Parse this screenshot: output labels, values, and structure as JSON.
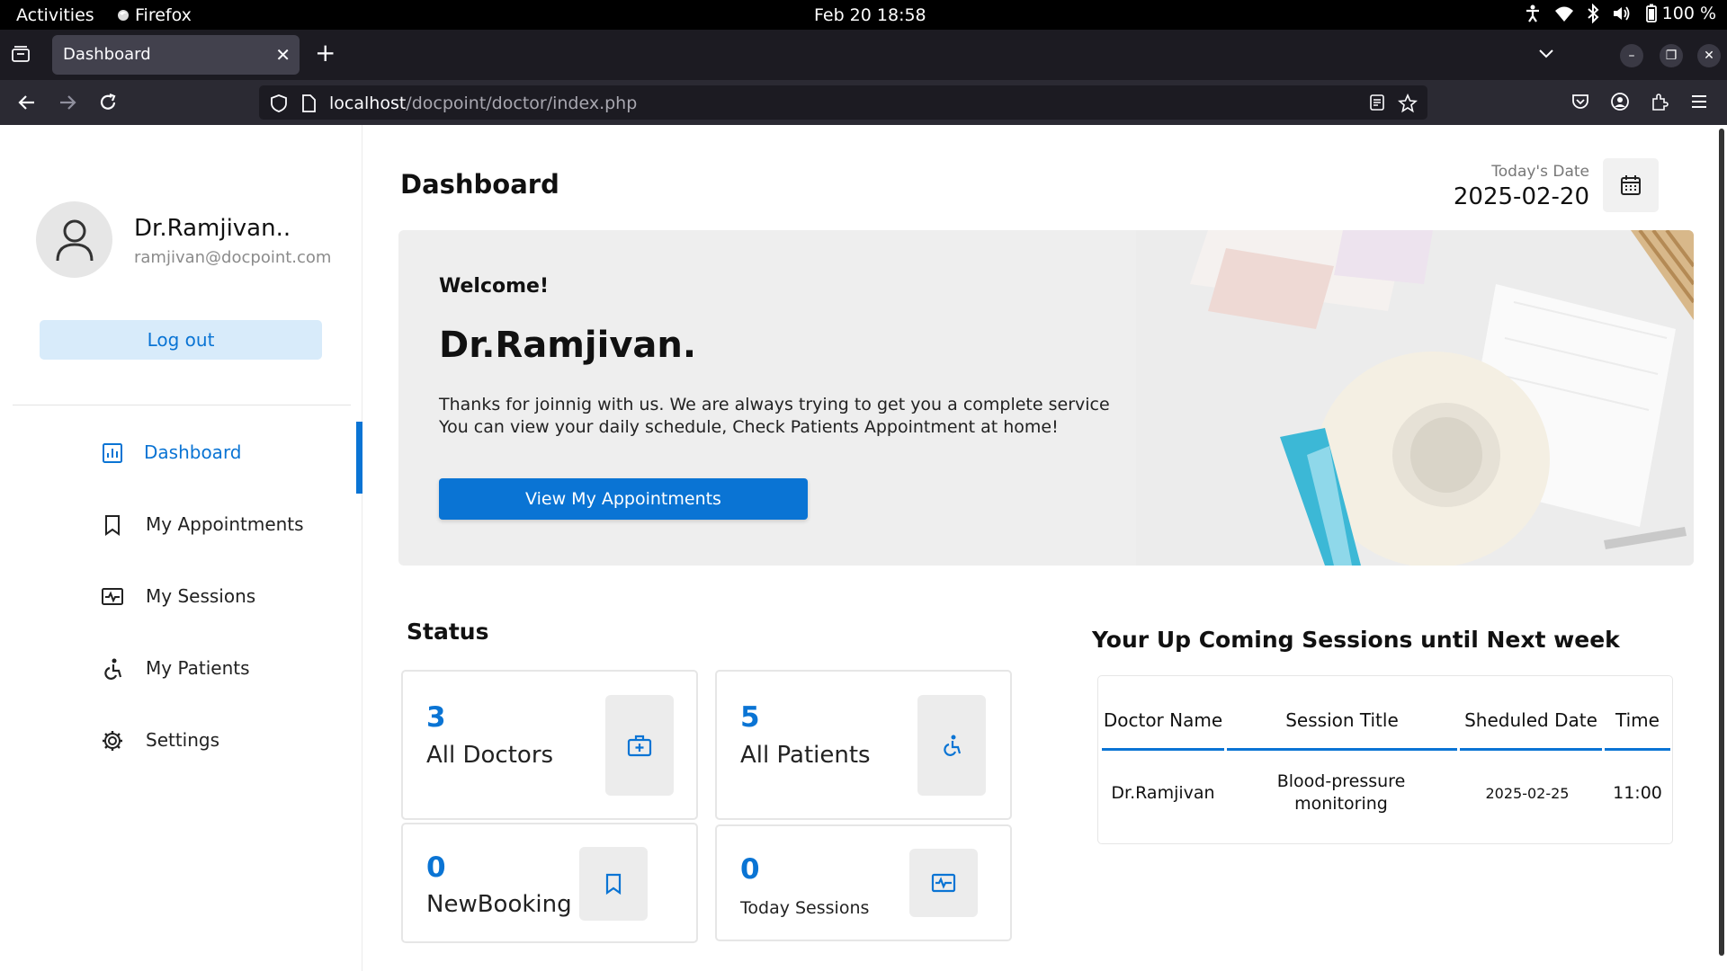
{
  "system": {
    "activities": "Activities",
    "app_name": "Firefox",
    "clock": "Feb 20  18:58",
    "battery": "100 %"
  },
  "browser": {
    "tab_title": "Dashboard",
    "url_host": "localhost",
    "url_path": "/docpoint/doctor/index.php"
  },
  "sidebar": {
    "profile_name": "Dr.Ramjivan..",
    "profile_email": "ramjivan@docpoint.com",
    "logout_label": "Log out",
    "items": [
      {
        "label": "Dashboard",
        "icon": "dashboard-icon",
        "active": true
      },
      {
        "label": "My Appointments",
        "icon": "bookmark-icon",
        "active": false
      },
      {
        "label": "My Sessions",
        "icon": "sessions-icon",
        "active": false
      },
      {
        "label": "My Patients",
        "icon": "patients-icon",
        "active": false
      },
      {
        "label": "Settings",
        "icon": "gear-icon",
        "active": false
      }
    ]
  },
  "main": {
    "title": "Dashboard",
    "date_label": "Today's Date",
    "date_value": "2025-02-20",
    "welcome": {
      "label": "Welcome!",
      "name": "Dr.Ramjivan.",
      "line1": "Thanks for joinnig with us. We are always trying to get you a complete service",
      "line2": "You can view your daily schedule, Check Patients Appointment at home!",
      "button": "View My Appointments"
    },
    "status": {
      "title": "Status",
      "cards": [
        {
          "value": "3",
          "label": "All Doctors",
          "icon": "doctor-bag-icon"
        },
        {
          "value": "5",
          "label": "All Patients",
          "icon": "patients-icon"
        },
        {
          "value": "0",
          "label": "NewBooking",
          "icon": "bookmark-icon"
        },
        {
          "value": "0",
          "label": "Today Sessions",
          "icon": "sessions-icon"
        }
      ]
    },
    "sessions": {
      "title": "Your Up Coming Sessions until Next week",
      "headers": [
        "Doctor Name",
        "Session Title",
        "Sheduled Date",
        "Time"
      ],
      "rows": [
        {
          "doctor": "Dr.Ramjivan",
          "title": "Blood-pressure monitoring",
          "date": "2025-02-25",
          "time": "11:00"
        }
      ]
    }
  },
  "colors": {
    "accent": "#0a74d4",
    "logout_bg": "#d8ebfa",
    "card_border": "#e6e6e6",
    "browser_bg": "#1c1b22"
  }
}
